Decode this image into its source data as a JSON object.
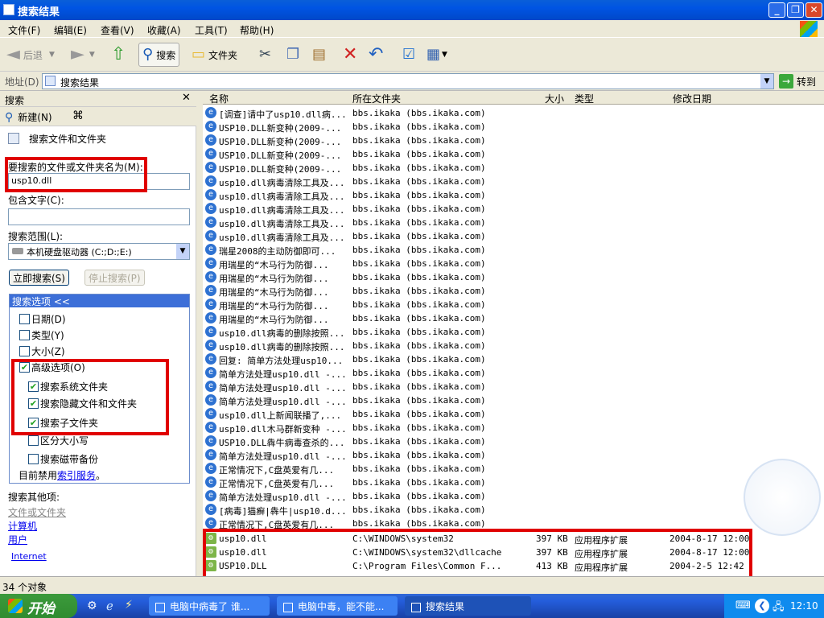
{
  "window": {
    "title": "搜索结果",
    "min": "_",
    "max": "❐",
    "close": "✕"
  },
  "menu": [
    "文件(F)",
    "编辑(E)",
    "查看(V)",
    "收藏(A)",
    "工具(T)",
    "帮助(H)"
  ],
  "toolbar": {
    "back": "后退",
    "search": "搜索",
    "folders": "文件夹"
  },
  "address": {
    "label": "地址(D)",
    "value": "搜索结果",
    "go": "转到"
  },
  "search_pane": {
    "title": "搜索",
    "new_label": "新建(N)",
    "header": "搜索文件和文件夹",
    "name_label": "要搜索的文件或文件夹名为(M):",
    "name_value": "usp10.dll",
    "contains_label": "包含文字(C):",
    "contains_value": "",
    "lookin_label": "搜索范围(L):",
    "lookin_value": "本机硬盘驱动器 (C:;D:;E:)",
    "search_now": "立即搜索(S)",
    "stop": "停止搜索(P)",
    "options_title": "搜索选项 <<",
    "options": [
      {
        "label": "日期(D)",
        "checked": false
      },
      {
        "label": "类型(Y)",
        "checked": false
      },
      {
        "label": "大小(Z)",
        "checked": false
      },
      {
        "label": "高级选项(O)",
        "checked": true
      }
    ],
    "advanced": [
      {
        "label": "搜索系统文件夹",
        "checked": true
      },
      {
        "label": "搜索隐藏文件和文件夹",
        "checked": true
      },
      {
        "label": "搜索子文件夹",
        "checked": true
      },
      {
        "label": "区分大小写",
        "checked": false
      },
      {
        "label": "搜索磁带备份",
        "checked": false
      }
    ],
    "index_text": "目前禁用",
    "index_link": "索引服务",
    "index_suffix": "。",
    "other_title": "搜索其他项:",
    "other_links": [
      "文件或文件夹",
      "计算机",
      "用户",
      "Internet"
    ]
  },
  "columns": {
    "name": "名称",
    "folder": "所在文件夹",
    "size": "大小",
    "type": "类型",
    "modified": "修改日期"
  },
  "results": [
    {
      "name": "[调查]请中了usp10.dll病...",
      "folder": "bbs.ikaka (bbs.ikaka.com)"
    },
    {
      "name": "USP10.DLL新变种(2009-...",
      "folder": "bbs.ikaka (bbs.ikaka.com)"
    },
    {
      "name": "USP10.DLL新变种(2009-...",
      "folder": "bbs.ikaka (bbs.ikaka.com)"
    },
    {
      "name": "USP10.DLL新变种(2009-...",
      "folder": "bbs.ikaka (bbs.ikaka.com)"
    },
    {
      "name": "USP10.DLL新变种(2009-...",
      "folder": "bbs.ikaka (bbs.ikaka.com)"
    },
    {
      "name": "usp10.dll病毒清除工具及...",
      "folder": "bbs.ikaka (bbs.ikaka.com)"
    },
    {
      "name": "usp10.dll病毒清除工具及...",
      "folder": "bbs.ikaka (bbs.ikaka.com)"
    },
    {
      "name": "usp10.dll病毒清除工具及...",
      "folder": "bbs.ikaka (bbs.ikaka.com)"
    },
    {
      "name": "usp10.dll病毒清除工具及...",
      "folder": "bbs.ikaka (bbs.ikaka.com)"
    },
    {
      "name": "usp10.dll病毒清除工具及...",
      "folder": "bbs.ikaka (bbs.ikaka.com)"
    },
    {
      "name": "瑞星2008的主动防御即可...",
      "folder": "bbs.ikaka (bbs.ikaka.com)"
    },
    {
      "name": "用瑞星的“木马行为防御...",
      "folder": "bbs.ikaka (bbs.ikaka.com)"
    },
    {
      "name": "用瑞星的“木马行为防御...",
      "folder": "bbs.ikaka (bbs.ikaka.com)"
    },
    {
      "name": "用瑞星的“木马行为防御...",
      "folder": "bbs.ikaka (bbs.ikaka.com)"
    },
    {
      "name": "用瑞星的“木马行为防御...",
      "folder": "bbs.ikaka (bbs.ikaka.com)"
    },
    {
      "name": "用瑞星的“木马行为防御...",
      "folder": "bbs.ikaka (bbs.ikaka.com)"
    },
    {
      "name": "usp10.dll病毒的删除按照...",
      "folder": "bbs.ikaka (bbs.ikaka.com)"
    },
    {
      "name": "usp10.dll病毒的删除按照...",
      "folder": "bbs.ikaka (bbs.ikaka.com)"
    },
    {
      "name": "回复: 简单方法处理usp10...",
      "folder": "bbs.ikaka (bbs.ikaka.com)"
    },
    {
      "name": "简单方法处理usp10.dll -...",
      "folder": "bbs.ikaka (bbs.ikaka.com)"
    },
    {
      "name": "简单方法处理usp10.dll -...",
      "folder": "bbs.ikaka (bbs.ikaka.com)"
    },
    {
      "name": "简单方法处理usp10.dll -...",
      "folder": "bbs.ikaka (bbs.ikaka.com)"
    },
    {
      "name": "usp10.dll上新闻联播了,...",
      "folder": "bbs.ikaka (bbs.ikaka.com)"
    },
    {
      "name": "usp10.dll木马群新变种 -...",
      "folder": "bbs.ikaka (bbs.ikaka.com)"
    },
    {
      "name": "USP10.DLL犇牛病毒查杀的...",
      "folder": "bbs.ikaka (bbs.ikaka.com)"
    },
    {
      "name": "简单方法处理usp10.dll -...",
      "folder": "bbs.ikaka (bbs.ikaka.com)"
    },
    {
      "name": "正常情况下,C盘英爱有几...",
      "folder": "bbs.ikaka (bbs.ikaka.com)"
    },
    {
      "name": "正常情况下,C盘英爱有几...",
      "folder": "bbs.ikaka (bbs.ikaka.com)"
    },
    {
      "name": "简单方法处理usp10.dll -...",
      "folder": "bbs.ikaka (bbs.ikaka.com)"
    },
    {
      "name": "[病毒]猫癣|犇牛|usp10.d...",
      "folder": "bbs.ikaka (bbs.ikaka.com)"
    },
    {
      "name": "正常情况下,C盘英爱有几...",
      "folder": "bbs.ikaka (bbs.ikaka.com)"
    }
  ],
  "files": [
    {
      "name": "usp10.dll",
      "folder": "C:\\WINDOWS\\system32",
      "size": "397 KB",
      "type": "应用程序扩展",
      "modified": "2004-8-17 12:00"
    },
    {
      "name": "usp10.dll",
      "folder": "C:\\WINDOWS\\system32\\dllcache",
      "size": "397 KB",
      "type": "应用程序扩展",
      "modified": "2004-8-17 12:00"
    },
    {
      "name": "USP10.DLL",
      "folder": "C:\\Program Files\\Common F...",
      "size": "413 KB",
      "type": "应用程序扩展",
      "modified": "2004-2-5 12:42"
    }
  ],
  "status": {
    "text": "34 个对象"
  },
  "taskbar": {
    "start": "开始",
    "tasks": [
      "电脑中病毒了 谁...",
      "电脑中毒，能不能...",
      "搜索结果"
    ],
    "clock": "12:10"
  },
  "colors": {
    "highlight_box": "#E00000",
    "title_blue": "#0054E3",
    "taskbar_blue": "#245DDB"
  }
}
